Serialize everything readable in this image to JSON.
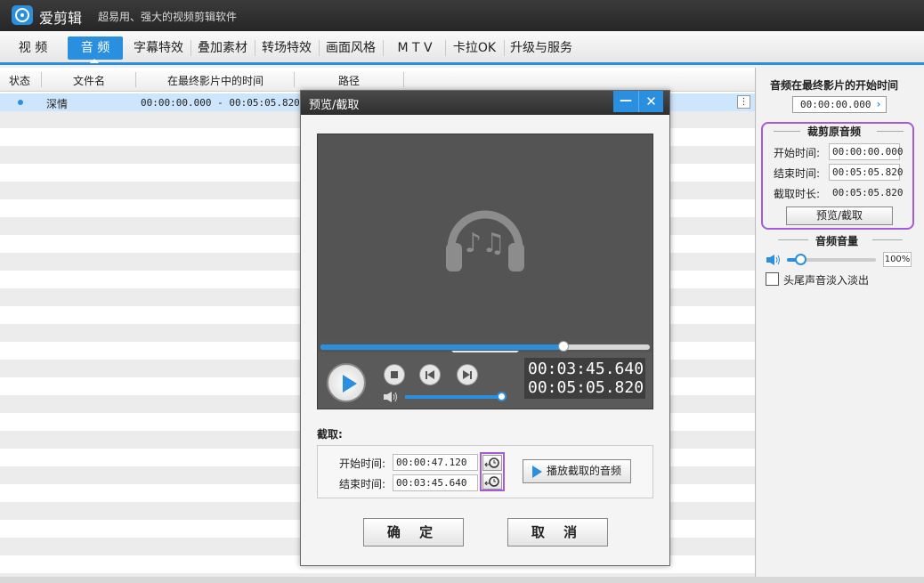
{
  "app": {
    "name": "爱剪辑",
    "slogan": "超易用、强大的视频剪辑软件",
    "logo_icon": "film-reel-icon"
  },
  "tabs": [
    {
      "label": "视 频",
      "active": false
    },
    {
      "label": "音 频",
      "active": true
    },
    {
      "label": "字幕特效",
      "active": false
    },
    {
      "label": "叠加素材",
      "active": false
    },
    {
      "label": "转场特效",
      "active": false
    },
    {
      "label": "画面风格",
      "active": false
    },
    {
      "label": "M T V",
      "active": false
    },
    {
      "label": "卡拉OK",
      "active": false
    },
    {
      "label": "升级与服务",
      "active": false
    }
  ],
  "list": {
    "columns": [
      "状态",
      "文件名",
      "在最终影片中的时间",
      "路径"
    ],
    "rows": [
      {
        "name": "深情",
        "time": "00:00:00.000 - 00:05:05.820",
        "selected": true
      }
    ]
  },
  "right_panel": {
    "start_title": "音频在最终影片的开始时间",
    "start_value": "00:00:00.000",
    "trim_title": "裁剪原音频",
    "start_label": "开始时间:",
    "start_time": "00:00:00.000",
    "end_label": "结束时间:",
    "end_time": "00:05:05.820",
    "duration_label": "截取时长:",
    "duration": "00:05:05.820",
    "preview_button": "预览/截取",
    "volume_title": "音频音量",
    "volume_value": "100%",
    "fade_label": "头尾声音淡入淡出",
    "fade_checked": false
  },
  "dialog": {
    "title": "预览/截取",
    "player": {
      "current_time": "00:03:45.640",
      "total_time": "00:05:05.820",
      "progress": 0.737,
      "volume": 0.97,
      "media_icon": "headphones-music-icon"
    },
    "cut_label": "截取:",
    "start_label": "开始时间:",
    "start_value": "00:00:47.120",
    "end_label": "结束时间:",
    "end_value": "00:03:45.640",
    "play_cut_button": "播放截取的音频",
    "ok_button": "确 定",
    "cancel_button": "取 消"
  },
  "colors": {
    "accent": "#2b8fe0",
    "highlight_border": "#a45bd8",
    "selected_row": "#cde6fb"
  }
}
